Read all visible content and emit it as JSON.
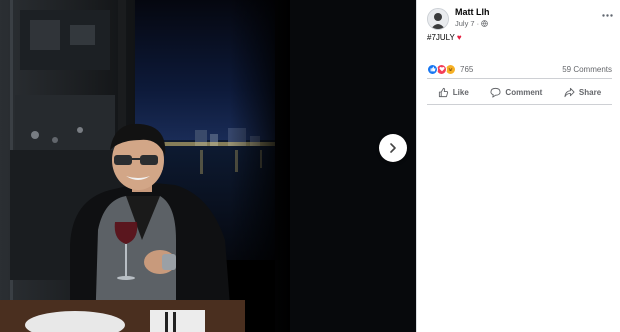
{
  "post": {
    "author": "Matt Llh",
    "time": "July 7 ·",
    "privacy_icon": "globe-icon",
    "caption": "#7JULY",
    "caption_emoji": "♥"
  },
  "stats": {
    "reaction_icons": [
      "like-icon",
      "love-icon",
      "haha-icon"
    ],
    "reaction_count": "765",
    "comments": "59 Comments"
  },
  "actions": {
    "like": "Like",
    "comment": "Comment",
    "share": "Share"
  },
  "colors": {
    "accent": "#1877f2",
    "love": "#f33e58",
    "haha": "#f7b125",
    "secondary_text": "#65676b"
  }
}
